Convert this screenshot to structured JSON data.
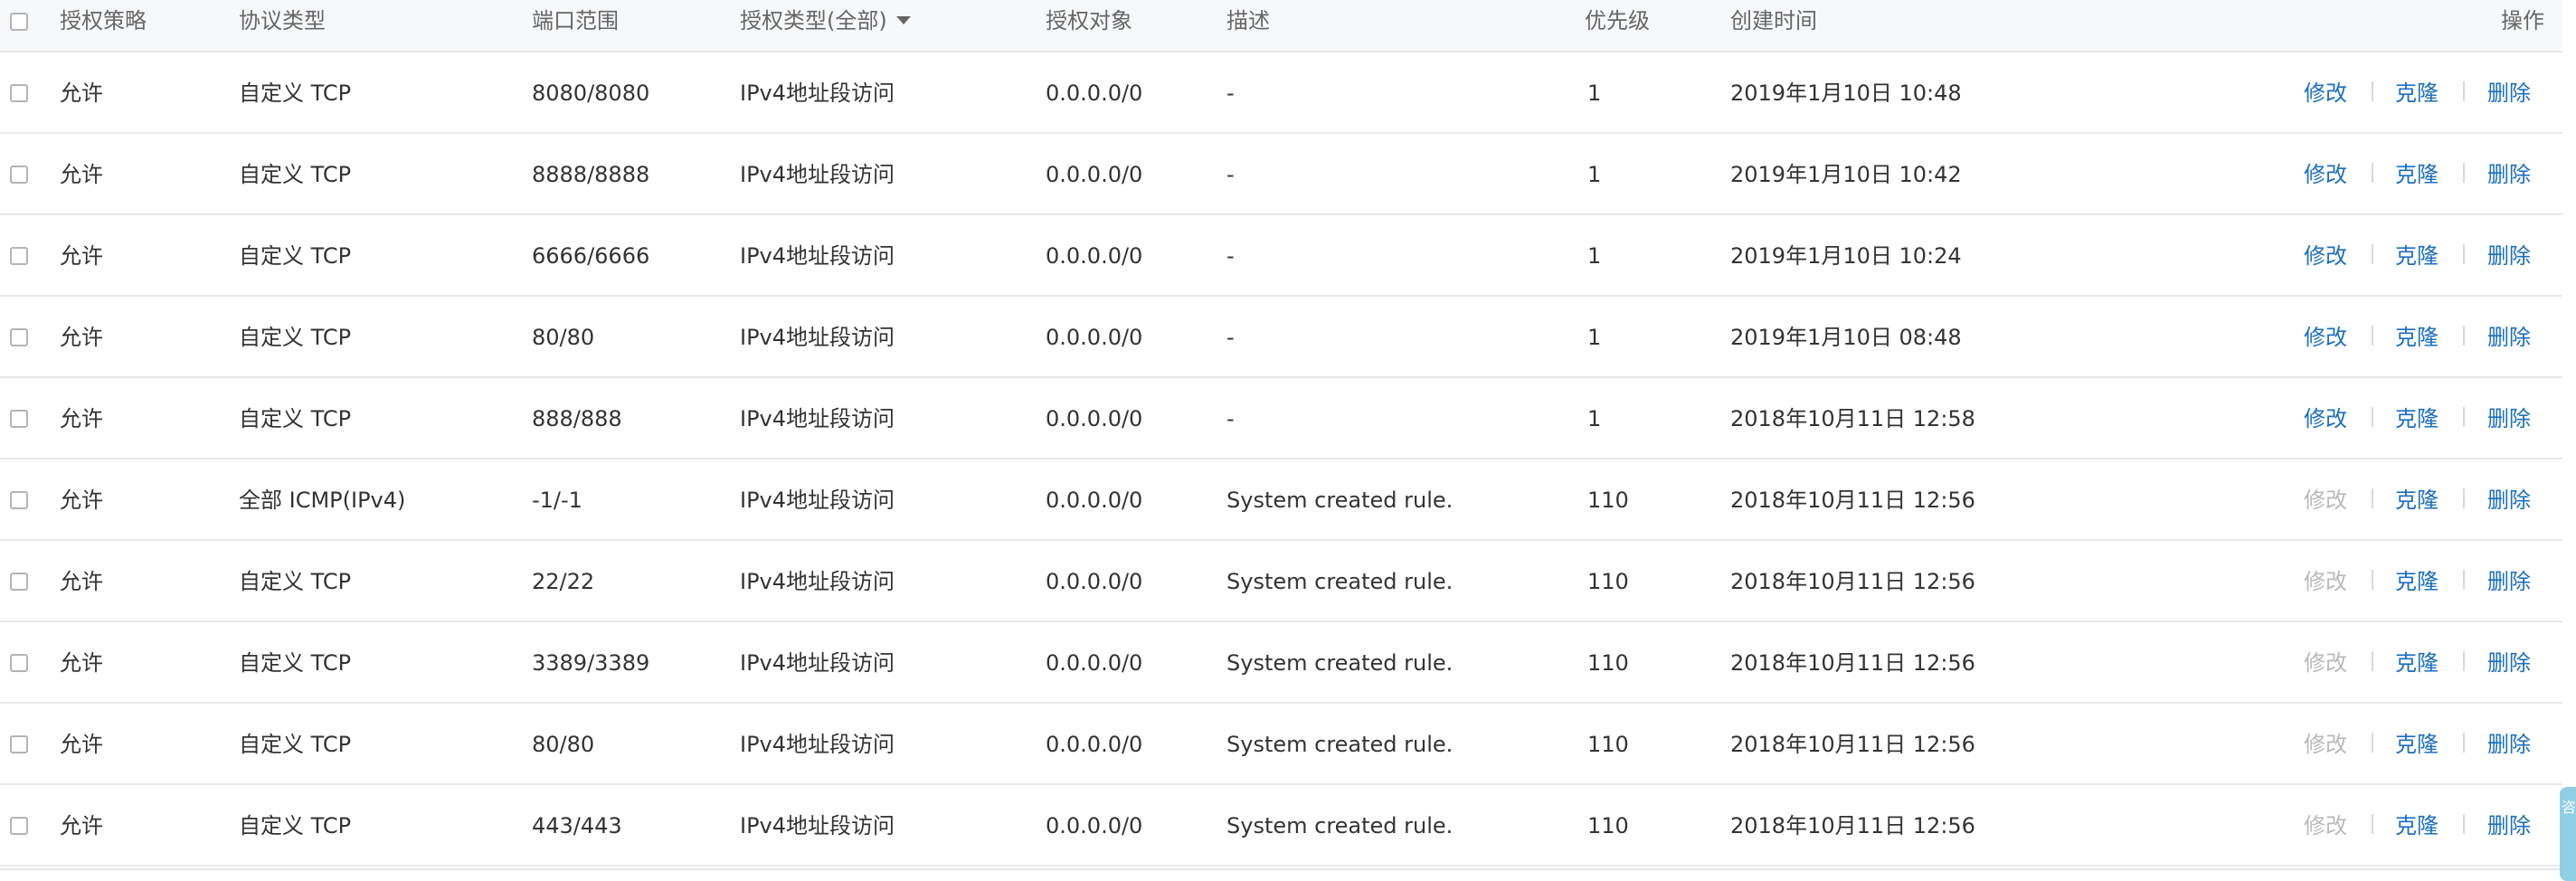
{
  "headers": {
    "policy": "授权策略",
    "protocol": "协议类型",
    "port_range": "端口范围",
    "auth_type": "授权类型(全部)",
    "auth_target": "授权对象",
    "description": "描述",
    "priority": "优先级",
    "created": "创建时间",
    "actions": "操作"
  },
  "actions": {
    "modify": "修改",
    "clone": "克隆",
    "delete": "删除"
  },
  "rows": [
    {
      "policy": "允许",
      "protocol": "自定义 TCP",
      "port_range": "8080/8080",
      "auth_type": "IPv4地址段访问",
      "auth_target": "0.0.0.0/0",
      "description": "-",
      "priority": "1",
      "created": "2019年1月10日 10:48",
      "modify_enabled": true
    },
    {
      "policy": "允许",
      "protocol": "自定义 TCP",
      "port_range": "8888/8888",
      "auth_type": "IPv4地址段访问",
      "auth_target": "0.0.0.0/0",
      "description": "-",
      "priority": "1",
      "created": "2019年1月10日 10:42",
      "modify_enabled": true
    },
    {
      "policy": "允许",
      "protocol": "自定义 TCP",
      "port_range": "6666/6666",
      "auth_type": "IPv4地址段访问",
      "auth_target": "0.0.0.0/0",
      "description": "-",
      "priority": "1",
      "created": "2019年1月10日 10:24",
      "modify_enabled": true
    },
    {
      "policy": "允许",
      "protocol": "自定义 TCP",
      "port_range": "80/80",
      "auth_type": "IPv4地址段访问",
      "auth_target": "0.0.0.0/0",
      "description": "-",
      "priority": "1",
      "created": "2019年1月10日 08:48",
      "modify_enabled": true
    },
    {
      "policy": "允许",
      "protocol": "自定义 TCP",
      "port_range": "888/888",
      "auth_type": "IPv4地址段访问",
      "auth_target": "0.0.0.0/0",
      "description": "-",
      "priority": "1",
      "created": "2018年10月11日 12:58",
      "modify_enabled": true
    },
    {
      "policy": "允许",
      "protocol": "全部 ICMP(IPv4)",
      "port_range": "-1/-1",
      "auth_type": "IPv4地址段访问",
      "auth_target": "0.0.0.0/0",
      "description": "System created rule.",
      "priority": "110",
      "created": "2018年10月11日 12:56",
      "modify_enabled": false
    },
    {
      "policy": "允许",
      "protocol": "自定义 TCP",
      "port_range": "22/22",
      "auth_type": "IPv4地址段访问",
      "auth_target": "0.0.0.0/0",
      "description": "System created rule.",
      "priority": "110",
      "created": "2018年10月11日 12:56",
      "modify_enabled": false
    },
    {
      "policy": "允许",
      "protocol": "自定义 TCP",
      "port_range": "3389/3389",
      "auth_type": "IPv4地址段访问",
      "auth_target": "0.0.0.0/0",
      "description": "System created rule.",
      "priority": "110",
      "created": "2018年10月11日 12:56",
      "modify_enabled": false
    },
    {
      "policy": "允许",
      "protocol": "自定义 TCP",
      "port_range": "80/80",
      "auth_type": "IPv4地址段访问",
      "auth_target": "0.0.0.0/0",
      "description": "System created rule.",
      "priority": "110",
      "created": "2018年10月11日 12:56",
      "modify_enabled": false
    },
    {
      "policy": "允许",
      "protocol": "自定义 TCP",
      "port_range": "443/443",
      "auth_type": "IPv4地址段访问",
      "auth_target": "0.0.0.0/0",
      "description": "System created rule.",
      "priority": "110",
      "created": "2018年10月11日 12:56",
      "modify_enabled": false
    }
  ],
  "colors": {
    "link": "#1b6ec2",
    "disabled": "#b9b9b9",
    "header_bg": "#f7f8fa",
    "side_tab": "#8ecfe6"
  },
  "side_tab": {
    "icon": "feedback-tab-icon",
    "text": "咨"
  }
}
